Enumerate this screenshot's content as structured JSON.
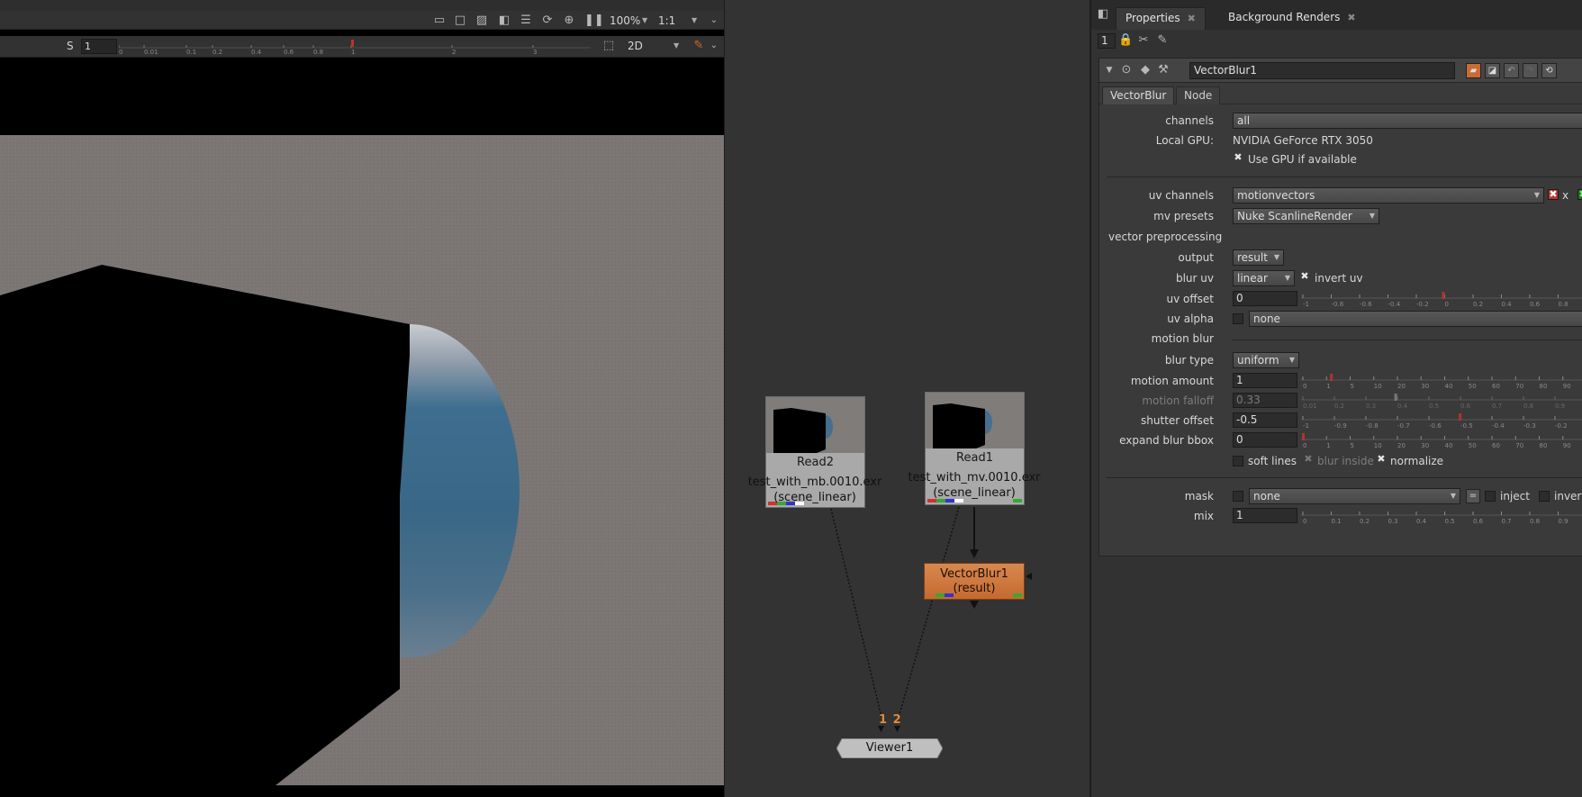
{
  "viewer": {
    "toolbar": {
      "zoom": "100%",
      "proxy": "1:1",
      "frame_label": "S",
      "frame_value": "1",
      "view_mode": "2D",
      "timeline_ticks": [
        "0",
        "0.01",
        "0.1",
        "0.2",
        "0.4",
        "0.6",
        "0.8",
        "1",
        "2",
        "3"
      ]
    }
  },
  "nodegraph": {
    "read2": {
      "title": "Read2",
      "file": "test_with_mb.0010.exr",
      "colorspace": "(scene_linear)"
    },
    "read1": {
      "title": "Read1",
      "file": "test_with_mv.0010.exr",
      "colorspace": "(scene_linear)"
    },
    "vectorblur": {
      "title": "VectorBlur1",
      "sub": "(result)"
    },
    "viewer": {
      "title": "Viewer1",
      "inputs": "1 2"
    }
  },
  "props": {
    "tabs": [
      "Properties",
      "Background Renders"
    ],
    "max_panels": "1",
    "node_name": "VectorBlur1",
    "knob_tabs": [
      "VectorBlur",
      "Node"
    ],
    "channels": {
      "label": "channels",
      "value": "all"
    },
    "local_gpu": {
      "label": "Local GPU:",
      "value": "NVIDIA GeForce RTX 3050"
    },
    "use_gpu": {
      "label": "Use GPU if available"
    },
    "uv_channels": {
      "label": "uv channels",
      "value": "motionvectors",
      "suffix": "x"
    },
    "mv_presets": {
      "label": "mv presets",
      "value": "Nuke ScanlineRender"
    },
    "vector_preprocessing": "vector preprocessing",
    "output": {
      "label": "output",
      "value": "result"
    },
    "blur_uv": {
      "label": "blur uv",
      "value": "linear",
      "invert_label": "invert uv"
    },
    "uv_offset": {
      "label": "uv offset",
      "value": "0",
      "ticks": [
        "-1",
        "-0.8",
        "-0.6",
        "-0.4",
        "-0.2",
        "0",
        "0.2",
        "0.4",
        "0.6",
        "0.8"
      ]
    },
    "uv_alpha": {
      "label": "uv alpha",
      "value": "none"
    },
    "motion_blur": "motion blur",
    "blur_type": {
      "label": "blur type",
      "value": "uniform"
    },
    "motion_amount": {
      "label": "motion amount",
      "value": "1",
      "ticks": [
        "0",
        "1",
        "5",
        "10",
        "20",
        "30",
        "40",
        "50",
        "60",
        "70",
        "80",
        "90"
      ]
    },
    "motion_falloff": {
      "label": "motion falloff",
      "value": "0.33",
      "ticks": [
        "0.01",
        "0.2",
        "0.3",
        "0.4",
        "0.5",
        "0.6",
        "0.7",
        "0.8",
        "0.9"
      ]
    },
    "shutter_offset": {
      "label": "shutter offset",
      "value": "-0.5",
      "ticks": [
        "-1",
        "-0.9",
        "-0.8",
        "-0.7",
        "-0.6",
        "-0.5",
        "-0.4",
        "-0.3",
        "-0.2"
      ]
    },
    "expand_blur_bbox": {
      "label": "expand blur bbox",
      "value": "0",
      "ticks": [
        "0",
        "1",
        "5",
        "10",
        "20",
        "30",
        "40",
        "50",
        "60",
        "70",
        "80",
        "90"
      ]
    },
    "soft_lines": "soft lines",
    "blur_inside": "blur inside",
    "normalize": "normalize",
    "mask": {
      "label": "mask",
      "value": "none",
      "inject": "inject",
      "invert": "invert"
    },
    "mix": {
      "label": "mix",
      "value": "1",
      "ticks": [
        "0",
        "0.1",
        "0.2",
        "0.3",
        "0.4",
        "0.5",
        "0.6",
        "0.7",
        "0.8",
        "0.9"
      ]
    }
  },
  "colors": {
    "viewer_bg": "#7c7774",
    "vectorblur_node": "#d07a3e",
    "read_node": "#a9a9a9",
    "sphere_blue": "#3d6d8d"
  }
}
